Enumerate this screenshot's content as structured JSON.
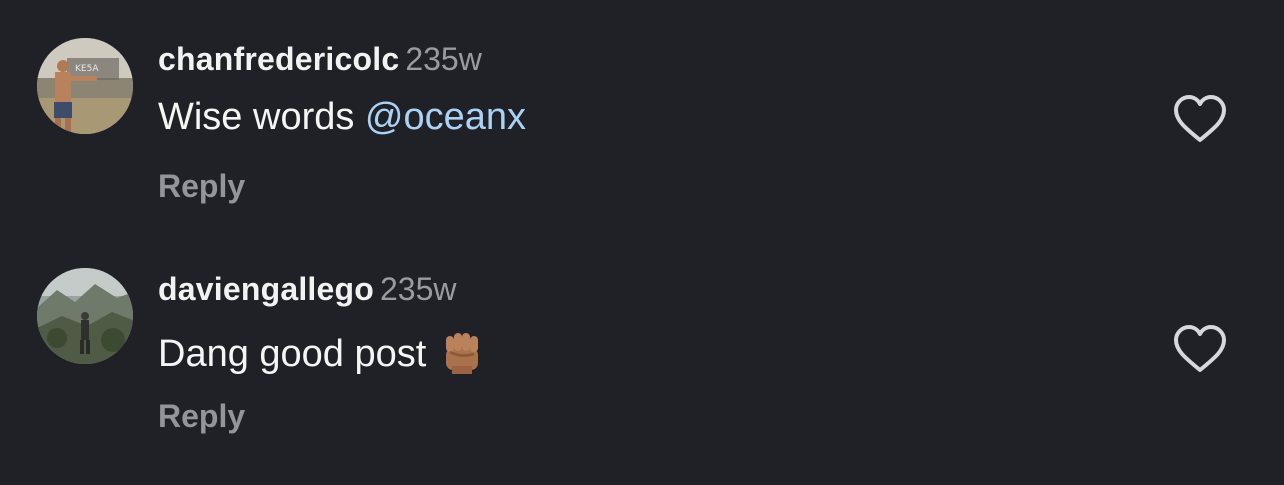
{
  "comments": [
    {
      "username": "chanfredericolc",
      "time": "235w",
      "text": "Wise words ",
      "mention": "@oceanx",
      "reply_label": "Reply",
      "avatar": "avatar-person-shirtless-outdoors",
      "like_icon": "heart-outline-icon"
    },
    {
      "username": "daviengallego",
      "time": "235w",
      "text": "Dang good post",
      "emoji": "raised-fist-medium-dark-skin-emoji",
      "reply_label": "Reply",
      "avatar": "avatar-person-mountains",
      "like_icon": "heart-outline-icon"
    }
  ],
  "colors": {
    "background": "#202126",
    "mention": "#a9d2f5",
    "secondary_text": "#9a9ba1"
  }
}
